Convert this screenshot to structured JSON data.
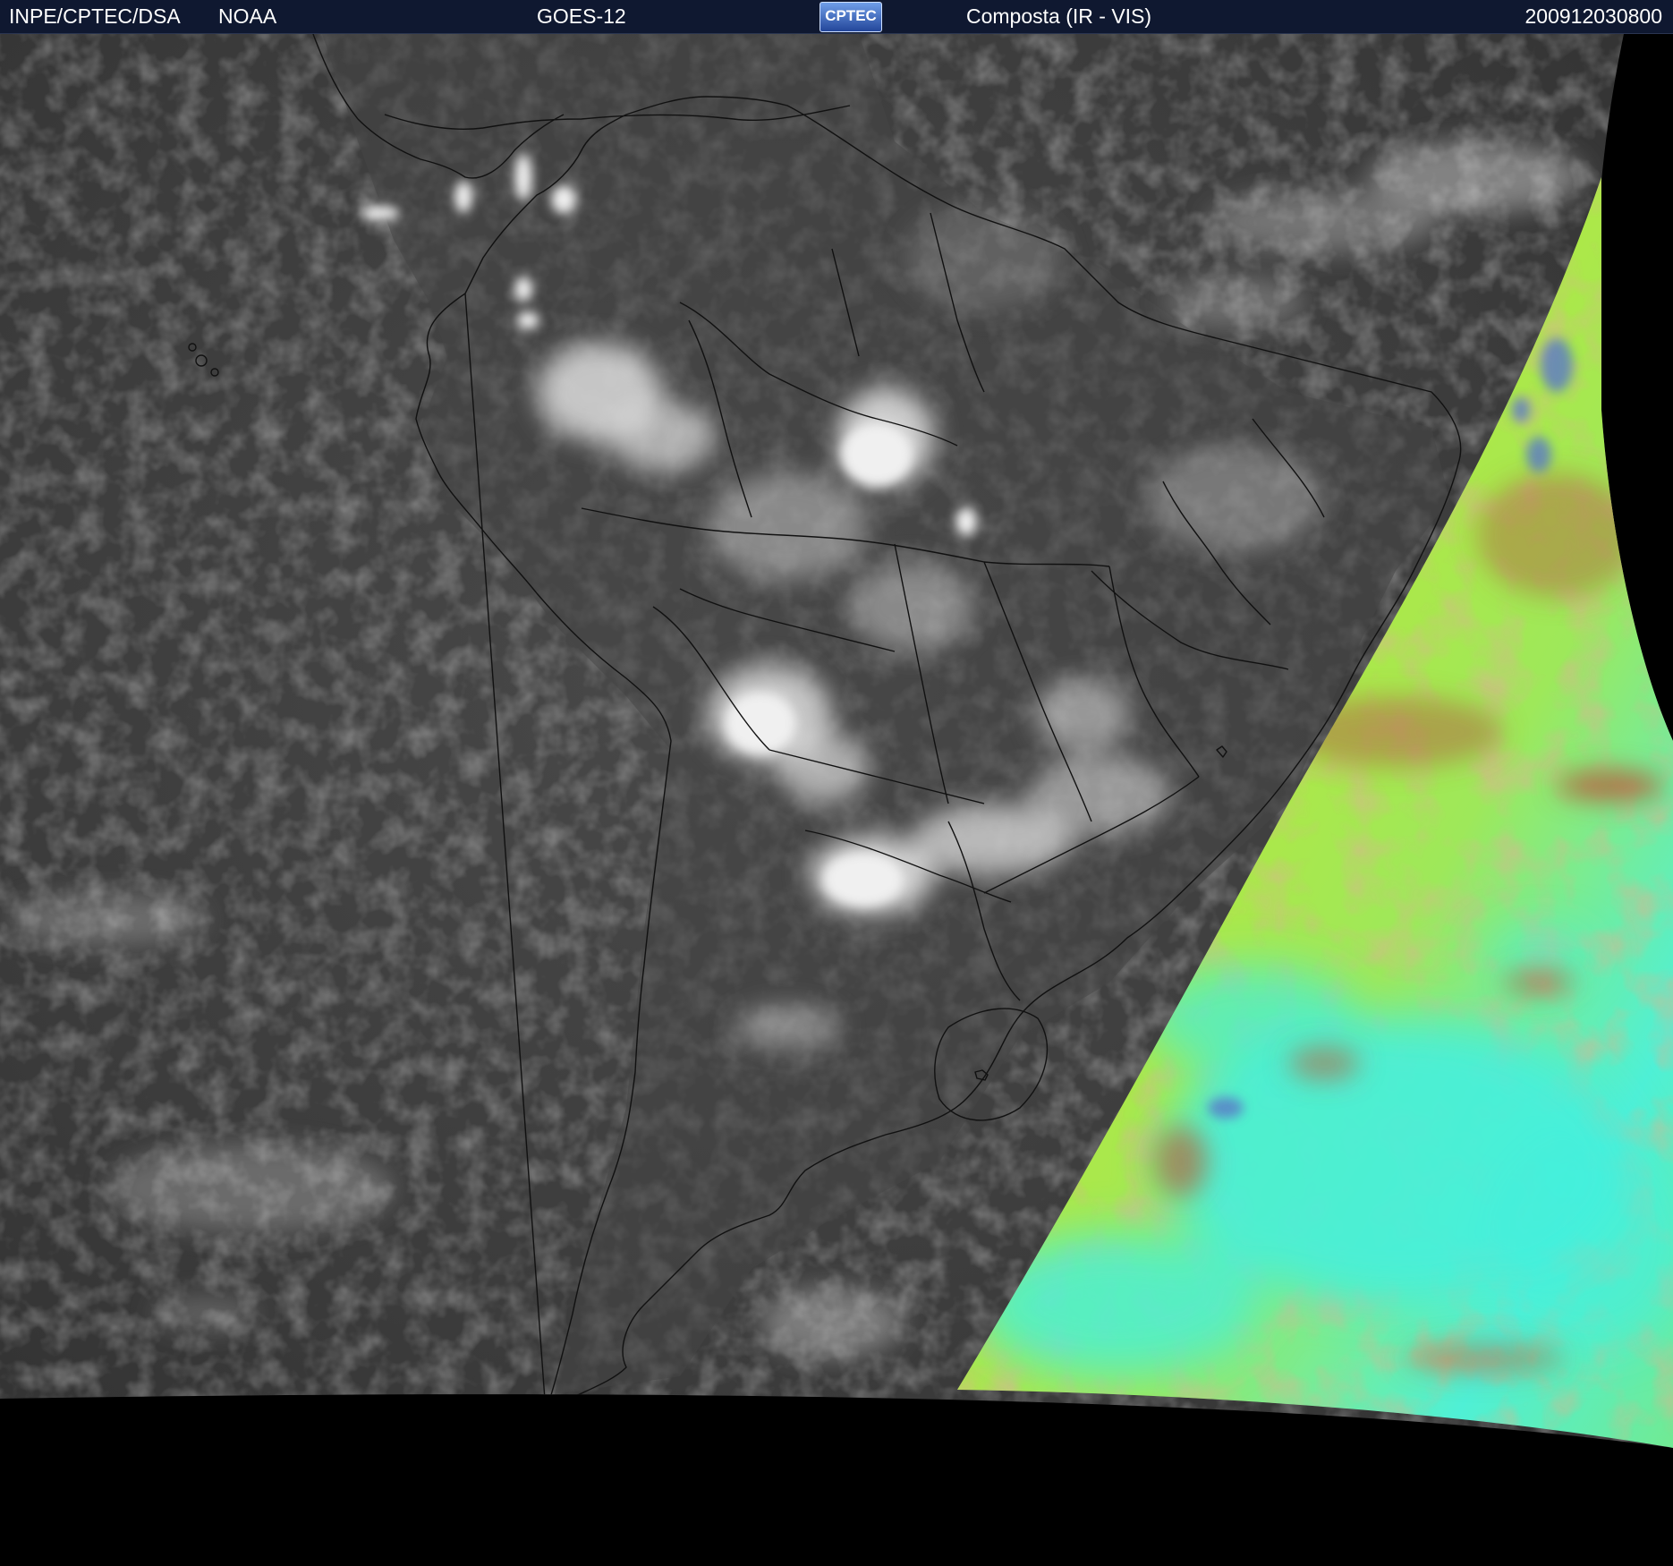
{
  "header": {
    "organization": "INPE/CPTEC/DSA",
    "agency": "NOAA",
    "satellite": "GOES-12",
    "logo_text": "CPTEC",
    "product": "Composta (IR - VIS)",
    "timestamp": "200912030800"
  },
  "image": {
    "description_colors": {
      "ocean_ir": "#3a3a3a",
      "cloud": "#d8d8d8",
      "vis_green": "#a6e83a",
      "vis_cyan": "#45f0dc",
      "vis_brown": "#b07848",
      "background": "#000000",
      "header_bg": "#0f1830"
    }
  }
}
